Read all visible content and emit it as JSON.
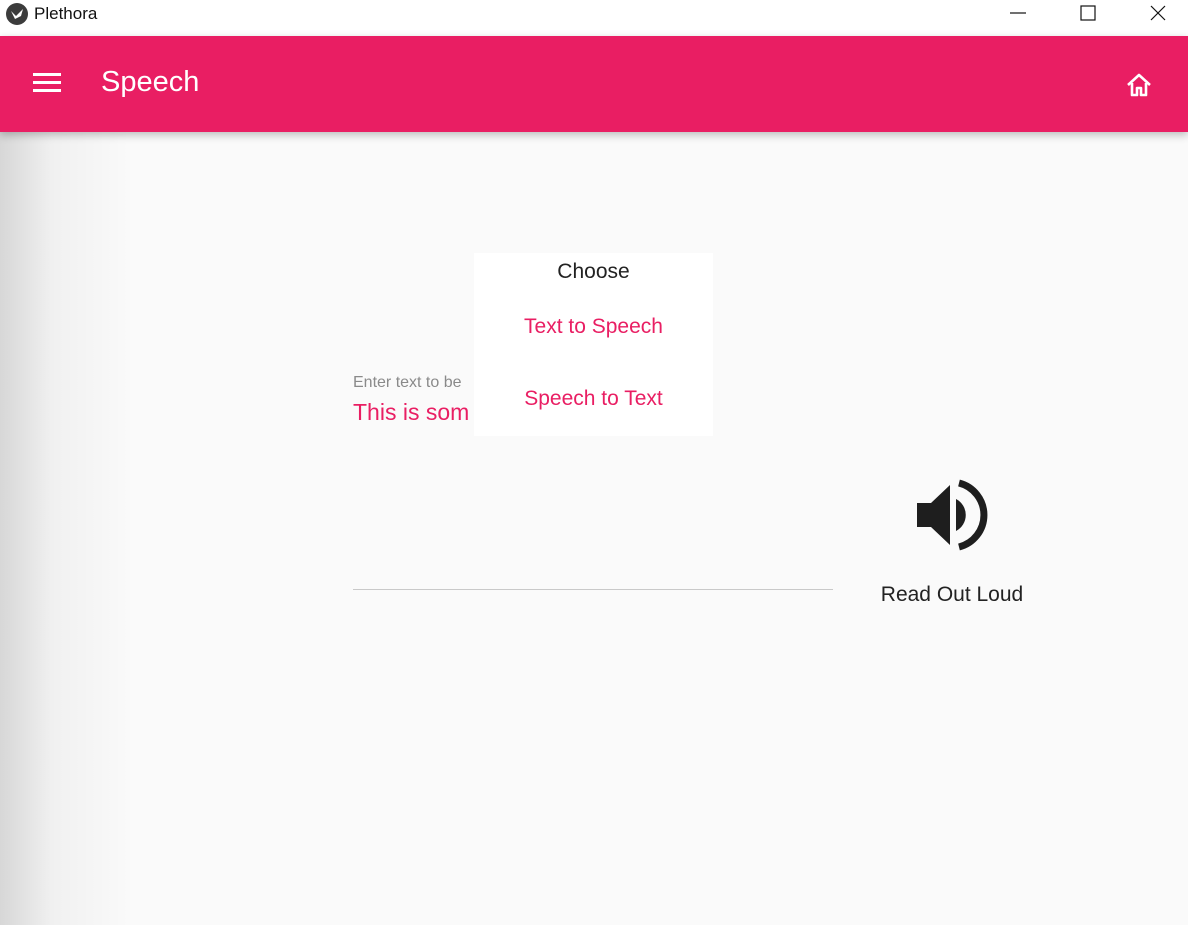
{
  "window": {
    "title": "Plethora",
    "controls": [
      "minimize",
      "maximize",
      "close"
    ]
  },
  "appbar": {
    "title": "Speech",
    "left_icon": "menu-icon",
    "right_icon": "home-icon",
    "color": "#e91e63"
  },
  "text_field": {
    "hint": "Enter text to be",
    "value": "This is som"
  },
  "speaker": {
    "icon": "volume-icon",
    "label": "Read Out Loud"
  },
  "chooser": {
    "title": "Choose",
    "options": [
      "Text to Speech",
      "Speech to Text"
    ]
  }
}
